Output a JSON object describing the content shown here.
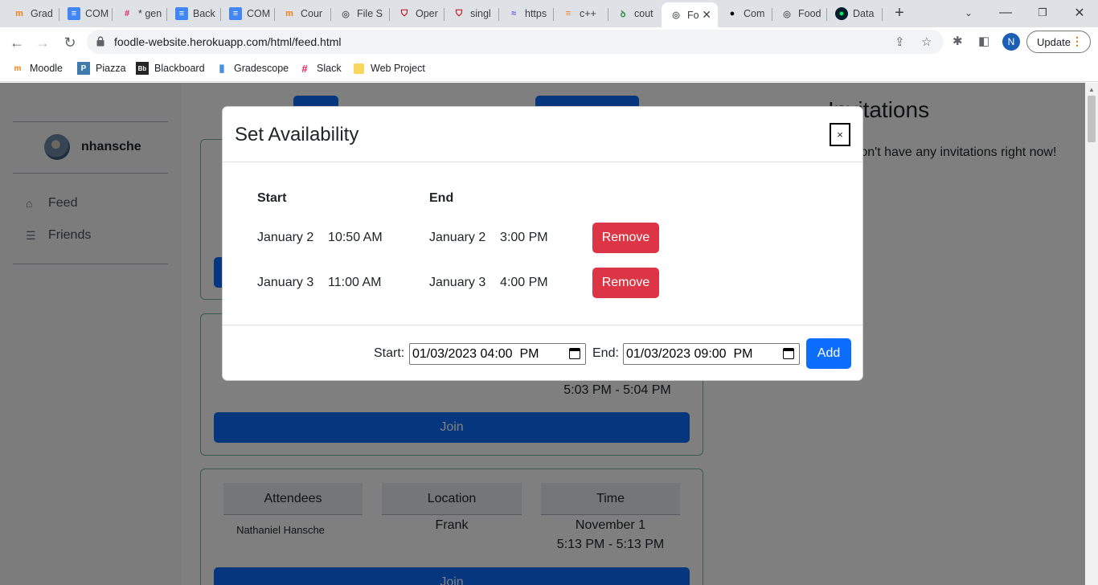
{
  "browser": {
    "tabs": [
      {
        "label": "Grad",
        "icon": "moodle-icon"
      },
      {
        "label": "COM",
        "icon": "docs-icon"
      },
      {
        "label": "* gen",
        "icon": "slack-icon"
      },
      {
        "label": "Back",
        "icon": "docs-icon"
      },
      {
        "label": "COM",
        "icon": "docs-icon"
      },
      {
        "label": "Cour",
        "icon": "moodle-icon"
      },
      {
        "label": "File S",
        "icon": "globe-icon"
      },
      {
        "label": "Oper",
        "icon": "shield-icon"
      },
      {
        "label": "singl",
        "icon": "shield-icon"
      },
      {
        "label": "https",
        "icon": "wave-icon"
      },
      {
        "label": "c++",
        "icon": "stackoverflow-icon"
      },
      {
        "label": "cout",
        "icon": "gfg-icon"
      },
      {
        "label": "Fo",
        "icon": "globe-icon",
        "active": true
      },
      {
        "label": "Com",
        "icon": "github-icon"
      },
      {
        "label": "Food",
        "icon": "globe-icon"
      },
      {
        "label": "Data",
        "icon": "mongodb-icon"
      }
    ],
    "url": "foodle-website.herokuapp.com/html/feed.html",
    "profile_initial": "N",
    "update_label": "Update",
    "bookmarks": [
      {
        "label": "Moodle",
        "icon": "moodle-icon"
      },
      {
        "label": "Piazza",
        "icon": "piazza-icon"
      },
      {
        "label": "Blackboard",
        "icon": "blackboard-icon"
      },
      {
        "label": "Gradescope",
        "icon": "gradescope-icon"
      },
      {
        "label": "Slack",
        "icon": "slack-icon"
      },
      {
        "label": "Web Project",
        "icon": "folder-icon"
      }
    ]
  },
  "sidebar": {
    "username": "nhansche",
    "items": [
      {
        "label": "Feed",
        "icon": "home-icon"
      },
      {
        "label": "Friends",
        "icon": "friends-icon"
      }
    ]
  },
  "feed": {
    "card2": {
      "time_line2": "5:03 PM - 5:04 PM",
      "join_label": "Join"
    },
    "card3": {
      "headers": [
        "Attendees",
        "Location",
        "Time"
      ],
      "attendee": "Nathaniel Hansche",
      "location": "Frank",
      "date": "November 1",
      "time": "5:13 PM - 5:13 PM",
      "join_label": "Join"
    }
  },
  "invitations": {
    "title": "Invitations",
    "empty_text": "You don't have any invitations right now!"
  },
  "modal": {
    "title": "Set Availability",
    "close_label": "×",
    "headers": {
      "start": "Start",
      "end": "End"
    },
    "rows": [
      {
        "start": "January 2    10:50 AM",
        "end": "January 2    3:00 PM",
        "action": "Remove"
      },
      {
        "start": "January 3    11:00 AM",
        "end": "January 3    4:00 PM",
        "action": "Remove"
      }
    ],
    "form": {
      "start_label": "Start:",
      "start_value": "01/03/2023 04:00  PM",
      "end_label": "End:",
      "end_value": "01/03/2023 09:00  PM",
      "add_label": "Add"
    }
  },
  "colors": {
    "primary": "#0d6efd",
    "danger": "#dc3545",
    "card_border": "#75b798"
  }
}
